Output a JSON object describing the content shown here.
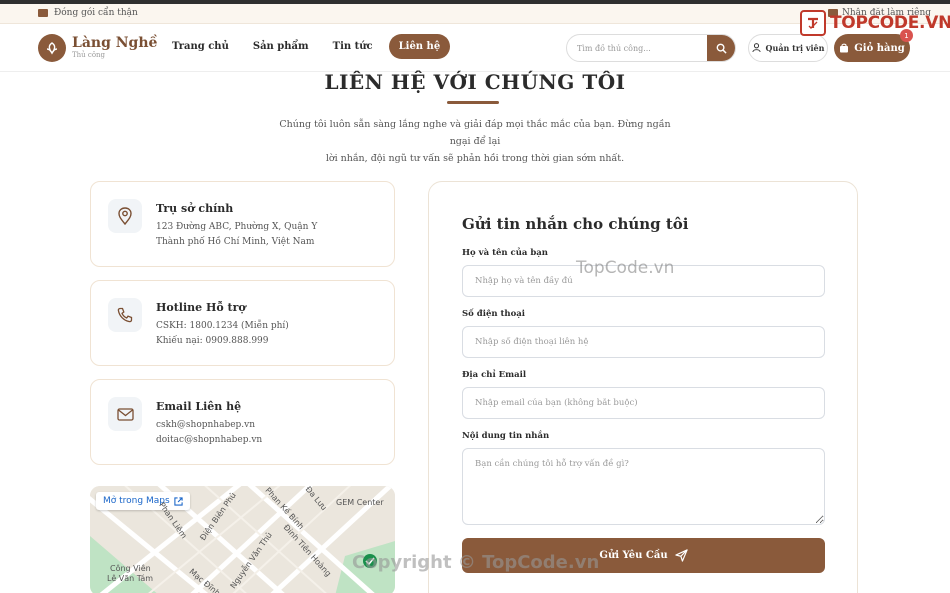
{
  "topbar": {
    "left_text": "Đóng gói cẩn thận",
    "right_text": "Nhận đặt làm riêng"
  },
  "brand_watermark": "TOPCODE.VN",
  "header": {
    "logo_name": "Làng Nghề",
    "logo_sub": "Thủ công",
    "nav": [
      "Trang chủ",
      "Sản phẩm",
      "Tin tức",
      "Liên hệ"
    ],
    "active_nav": "Liên hệ",
    "search_placeholder": "Tìm đồ thủ công...",
    "admin_label": "Quản trị viên",
    "cart_label": "Giỏ hàng",
    "cart_count": "1"
  },
  "main": {
    "title": "LIÊN HỆ VỚI CHÚNG TÔI",
    "intro_line1": "Chúng tôi luôn sẵn sàng lắng nghe và giải đáp mọi thắc mắc của bạn. Đừng ngần ngại để lại",
    "intro_line2": "lời nhắn, đội ngũ tư vấn sẽ phản hồi trong thời gian sớm nhất."
  },
  "info_cards": [
    {
      "icon": "map-pin-icon",
      "title": "Trụ sở chính",
      "line1": "123 Đường ABC, Phường X, Quận Y",
      "line2": "Thành phố Hồ Chí Minh, Việt Nam"
    },
    {
      "icon": "phone-icon",
      "title": "Hotline Hỗ trợ",
      "line1": "CSKH: 1800.1234 (Miễn phí)",
      "line2": "Khiếu nại: 0909.888.999"
    },
    {
      "icon": "mail-icon",
      "title": "Email Liên hệ",
      "line1": "cskh@shopnhabep.vn",
      "line2": "doitac@shopnhabep.vn"
    }
  ],
  "map": {
    "open_label": "Mở trong Maps",
    "labels": [
      "Phan Liêm",
      "Điện Biên Phủ",
      "Phan Kế Bính",
      "GEM Center",
      "Đinh Tiên Hoàng",
      "Nguyễn Văn Thủ",
      "Mạc Đĩnh",
      "Công Viên",
      "Lê Văn Tám",
      "Đa Lưu"
    ]
  },
  "form": {
    "title": "Gửi tin nhắn cho chúng tôi",
    "name_label": "Họ và tên của bạn",
    "name_placeholder": "Nhập họ và tên đầy đủ",
    "phone_label": "Số điện thoại",
    "phone_placeholder": "Nhập số điện thoại liên hệ",
    "email_label": "Địa chỉ Email",
    "email_placeholder": "Nhập email của bạn (không bắt buộc)",
    "message_label": "Nội dung tin nhắn",
    "message_placeholder": "Bạn cần chúng tôi hỗ trợ vấn đề gì?",
    "submit_label": "Gửi Yêu Cầu"
  },
  "watermarks": {
    "center": "TopCode.vn",
    "bottom": "Copyright © TopCode.vn"
  },
  "colors": {
    "primary": "#8a5a3b",
    "text": "#2b2b2b",
    "brand_watermark": "#c0392b"
  }
}
